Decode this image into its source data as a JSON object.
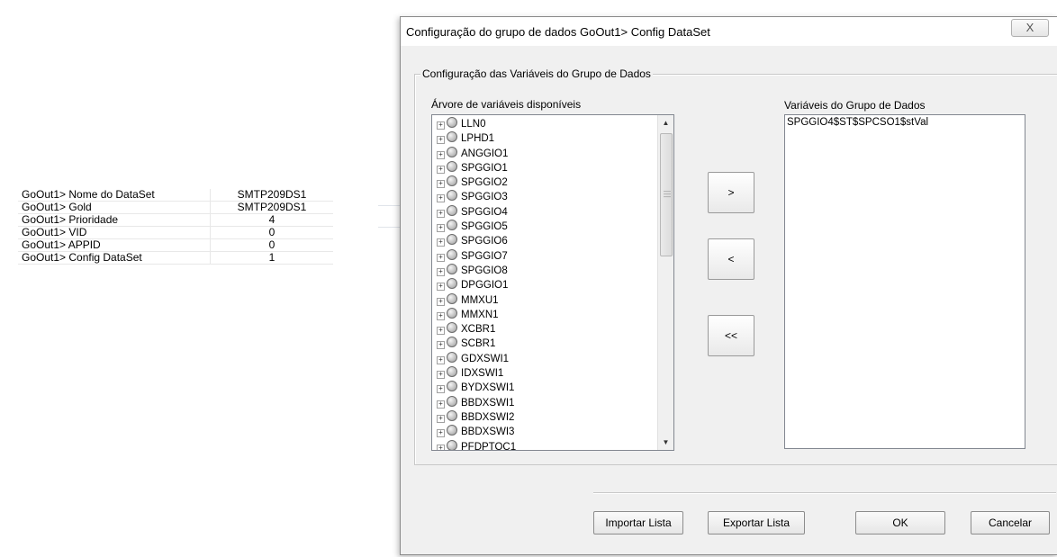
{
  "properties": [
    {
      "key": "GoOut1> Nome do DataSet",
      "value": "SMTP209DS1"
    },
    {
      "key": "GoOut1> Gold",
      "value": "SMTP209DS1"
    },
    {
      "key": "GoOut1> Prioridade",
      "value": "4"
    },
    {
      "key": "GoOut1> VID",
      "value": "0"
    },
    {
      "key": "GoOut1> APPID",
      "value": "0"
    },
    {
      "key": "GoOut1> Config DataSet",
      "value": "1"
    }
  ],
  "dialog": {
    "title": "Configuração do grupo de dados GoOut1> Config DataSet",
    "close_label": "X",
    "group_label": "Configuração das Variáveis do Grupo de Dados",
    "tree_label": "Árvore de variáveis disponíveis",
    "dataset_label": "Variáveis do Grupo de Dados",
    "tree_items": [
      "LLN0",
      "LPHD1",
      "ANGGIO1",
      "SPGGIO1",
      "SPGGIO2",
      "SPGGIO3",
      "SPGGIO4",
      "SPGGIO5",
      "SPGGIO6",
      "SPGGIO7",
      "SPGGIO8",
      "DPGGIO1",
      "MMXU1",
      "MMXN1",
      "XCBR1",
      "SCBR1",
      "GDXSWI1",
      "IDXSWI1",
      "BYDXSWI1",
      "BBDXSWI1",
      "BBDXSWI2",
      "BBDXSWI3",
      "PFDPTOC1"
    ],
    "dataset_items": [
      "SPGGIO4$ST$SPCSO1$stVal"
    ],
    "add_label": ">",
    "remove_label": "<",
    "remove_all_label": "<<",
    "import_label": "Importar Lista",
    "export_label": "Exportar Lista",
    "ok_label": "OK",
    "cancel_label": "Cancelar",
    "expander_glyph": "+",
    "scroll_up_glyph": "▲",
    "scroll_down_glyph": "▼"
  }
}
